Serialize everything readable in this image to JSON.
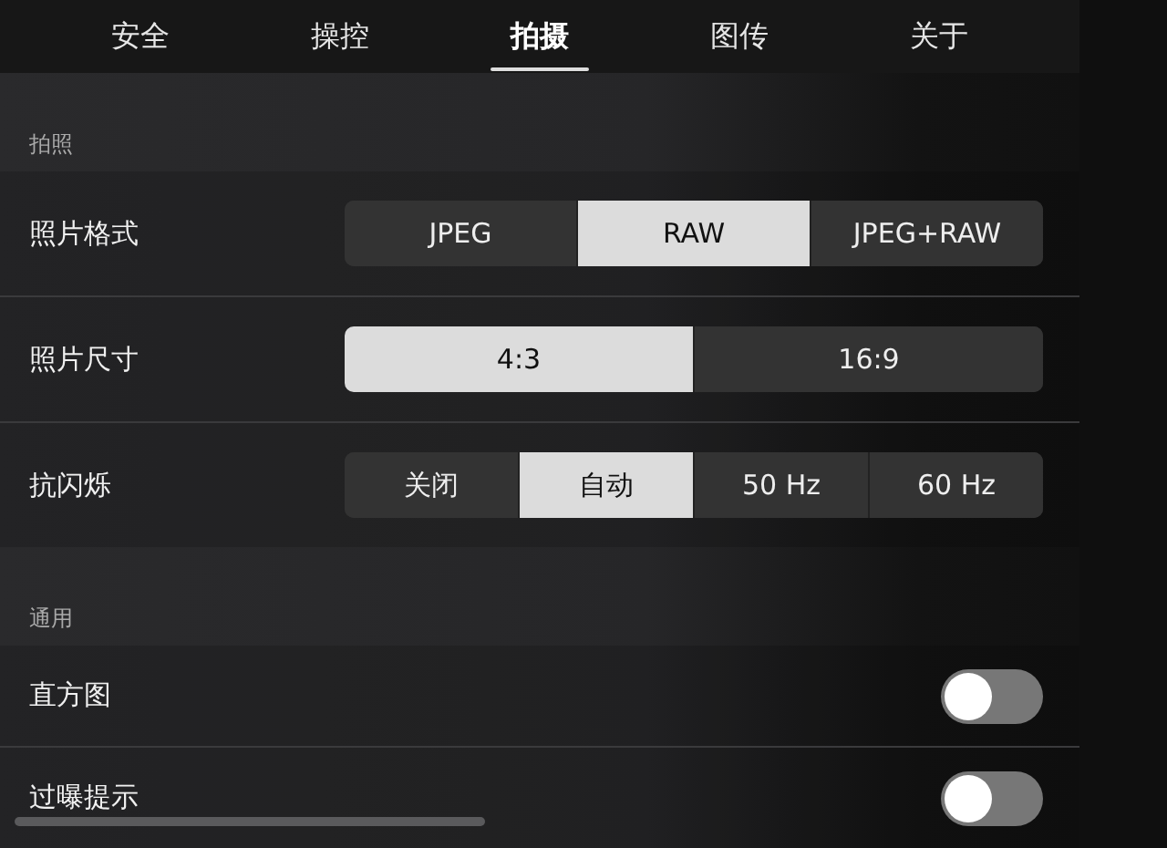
{
  "tabs": [
    {
      "label": "安全",
      "selected": false
    },
    {
      "label": "操控",
      "selected": false
    },
    {
      "label": "拍摄",
      "selected": true
    },
    {
      "label": "图传",
      "selected": false
    },
    {
      "label": "关于",
      "selected": false
    }
  ],
  "sections": [
    {
      "title": "拍照",
      "rows": [
        {
          "kind": "segmented",
          "label": "照片格式",
          "options": [
            {
              "label": "JPEG",
              "selected": false
            },
            {
              "label": "RAW",
              "selected": true
            },
            {
              "label": "JPEG+RAW",
              "selected": false
            }
          ]
        },
        {
          "kind": "segmented",
          "label": "照片尺寸",
          "options": [
            {
              "label": "4:3",
              "selected": true
            },
            {
              "label": "16:9",
              "selected": false
            }
          ]
        },
        {
          "kind": "segmented",
          "label": "抗闪烁",
          "options": [
            {
              "label": "关闭",
              "selected": false
            },
            {
              "label": "自动",
              "selected": true
            },
            {
              "label": "50 Hz",
              "selected": false
            },
            {
              "label": "60 Hz",
              "selected": false
            }
          ]
        }
      ]
    },
    {
      "title": "通用",
      "rows": [
        {
          "kind": "toggle",
          "label": "直方图",
          "on": false
        },
        {
          "kind": "toggle",
          "label": "过曝提示",
          "on": false
        }
      ]
    }
  ]
}
